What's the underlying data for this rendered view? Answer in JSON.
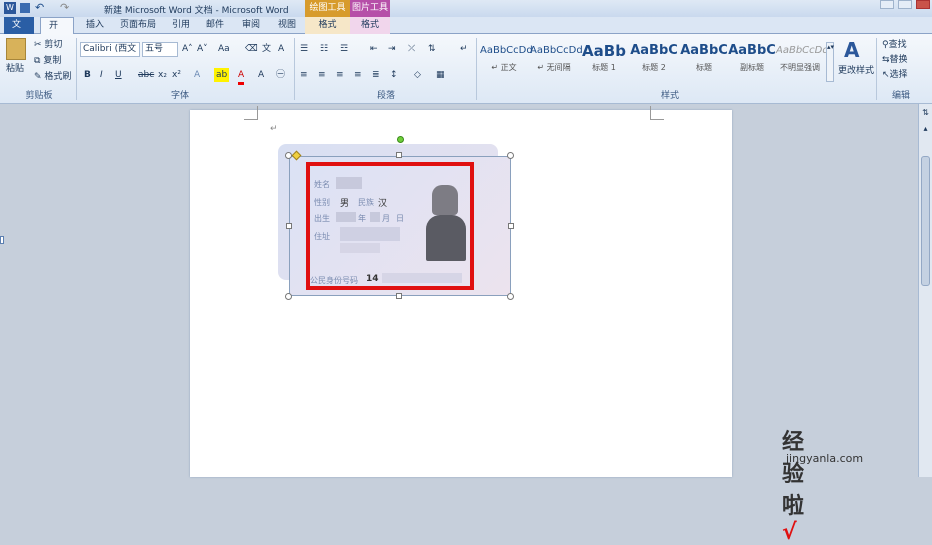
{
  "titlebar": {
    "title": "新建 Microsoft Word 文档 - Microsoft Word",
    "ctx_drawing": "绘图工具",
    "ctx_picture": "图片工具"
  },
  "tabs": [
    "文件",
    "开始",
    "插入",
    "页面布局",
    "引用",
    "邮件",
    "审阅",
    "视图"
  ],
  "ctx_tabs": [
    "格式",
    "格式"
  ],
  "clipboard": {
    "paste": "粘贴",
    "cut": "剪切",
    "copy": "复制",
    "format_painter": "格式刷",
    "label": "剪贴板"
  },
  "font": {
    "name": "Calibri (西文",
    "size": "五号",
    "label": "字体"
  },
  "paragraph": {
    "label": "段落"
  },
  "styles": {
    "items": [
      {
        "sample": "AaBbCcDd",
        "name": "↵ 正文"
      },
      {
        "sample": "AaBbCcDd",
        "name": "↵ 无间隔"
      },
      {
        "sample": "AaBb",
        "name": "标题 1"
      },
      {
        "sample": "AaBbC",
        "name": "标题 2"
      },
      {
        "sample": "AaBbC",
        "name": "标题"
      },
      {
        "sample": "AaBbC",
        "name": "副标题"
      },
      {
        "sample": "AaBbCcDd",
        "name": "不明显强调"
      }
    ],
    "change": "更改样式",
    "label": "样式"
  },
  "editing": {
    "find": "查找",
    "replace": "替换",
    "select": "选择",
    "label": "编辑"
  },
  "card": {
    "name_label": "姓名",
    "sex_label": "性别",
    "sex": "男",
    "nation_label": "民族",
    "nation": "汉",
    "birth_label": "出生",
    "year": "年",
    "month": "月",
    "day": "日",
    "address_label": "住址",
    "id_label": "公民身份号码",
    "id_prefix": "14"
  },
  "watermark": {
    "site": "经验啦",
    "url": "jingyanla.com"
  }
}
